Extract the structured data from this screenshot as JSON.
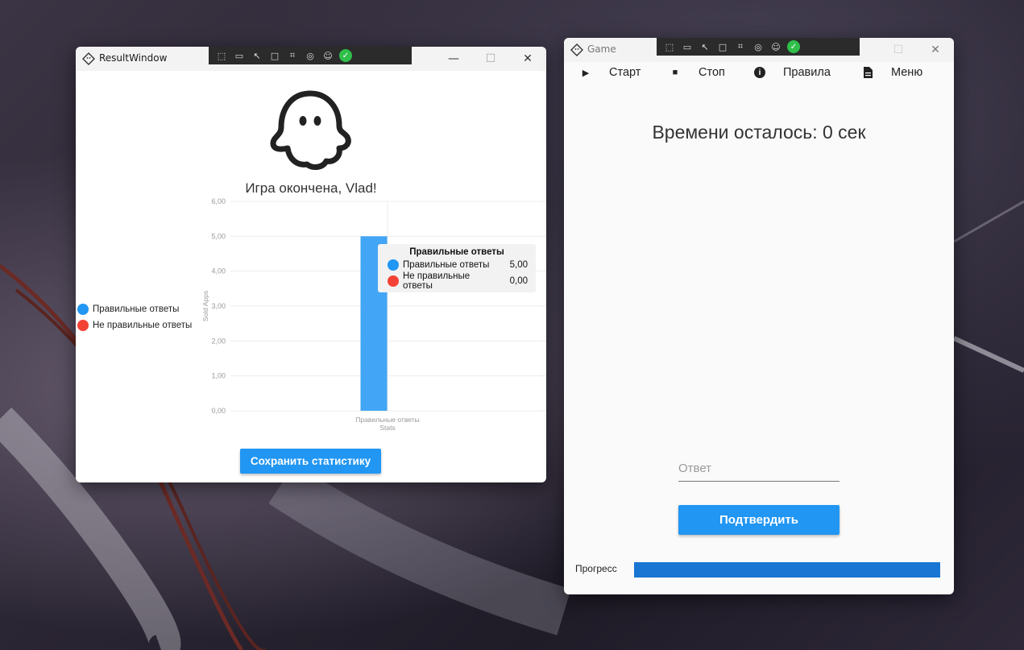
{
  "result_window": {
    "title": "ResultWindow",
    "heading": "Игра окончена, Vlad!",
    "save_button": "Сохранить статистику",
    "legend": [
      {
        "label": "Правильные ответы",
        "color": "#2196f3"
      },
      {
        "label": "Не правильные ответы",
        "color": "#f44336"
      }
    ],
    "tooltip": {
      "title": "Правильные ответы",
      "rows": [
        {
          "label": "Правильные ответы",
          "value": "5,00",
          "color": "#2196f3"
        },
        {
          "label": "Не правильные ответы",
          "value": "0,00",
          "color": "#f44336"
        }
      ]
    }
  },
  "chart_data": {
    "type": "bar",
    "categories": [
      "Правильные ответы"
    ],
    "series": [
      {
        "name": "Правильные ответы",
        "values": [
          5
        ],
        "color": "#42a5f5"
      },
      {
        "name": "Не правильные ответы",
        "values": [
          0
        ],
        "color": "#f44336"
      }
    ],
    "ylabel": "Sold Apps",
    "xlabel": "Stats",
    "ylim": [
      0,
      6
    ],
    "yticks": [
      "0,00",
      "1,00",
      "2,00",
      "3,00",
      "4,00",
      "5,00",
      "6,00"
    ],
    "grid": true,
    "legend_position": "left"
  },
  "game_window": {
    "title": "Game",
    "menu": [
      {
        "label": "Старт",
        "icon": "play-icon"
      },
      {
        "label": "Стоп",
        "icon": "stop-icon"
      },
      {
        "label": "Правила",
        "icon": "info-icon"
      },
      {
        "label": "Меню",
        "icon": "document-icon"
      }
    ],
    "timer_text": "Времени осталось: 0 сек",
    "answer_placeholder": "Ответ",
    "confirm_button": "Подтвердить",
    "progress_label": "Прогресс",
    "progress_value": 1.0
  }
}
